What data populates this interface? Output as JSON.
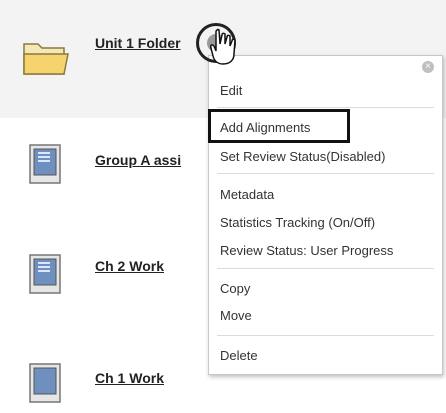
{
  "rows": [
    {
      "title": "Unit 1 Folder",
      "icon": "folder-icon"
    },
    {
      "title": "Group A assi",
      "icon": "assignment-icon"
    },
    {
      "title": "Ch 2 Work",
      "icon": "assignment-icon"
    },
    {
      "title": "Ch 1 Work",
      "icon": "assignment-icon"
    }
  ],
  "menu": {
    "items": [
      {
        "label": "Edit"
      },
      {
        "label": "Add Alignments"
      },
      {
        "label": "Set Review Status(Disabled)"
      },
      {
        "label": "Metadata"
      },
      {
        "label": "Statistics Tracking (On/Off)"
      },
      {
        "label": "Review Status: User Progress"
      },
      {
        "label": "Copy"
      },
      {
        "label": "Move"
      },
      {
        "label": "Delete"
      }
    ]
  },
  "colors": {
    "menu_border": "#c7c7c7",
    "row_bg_highlighted": "#f3f3f3",
    "folder": "#f6d36e"
  },
  "icons": {
    "close": "close-icon",
    "hand_cursor": "hand-cursor-icon"
  }
}
